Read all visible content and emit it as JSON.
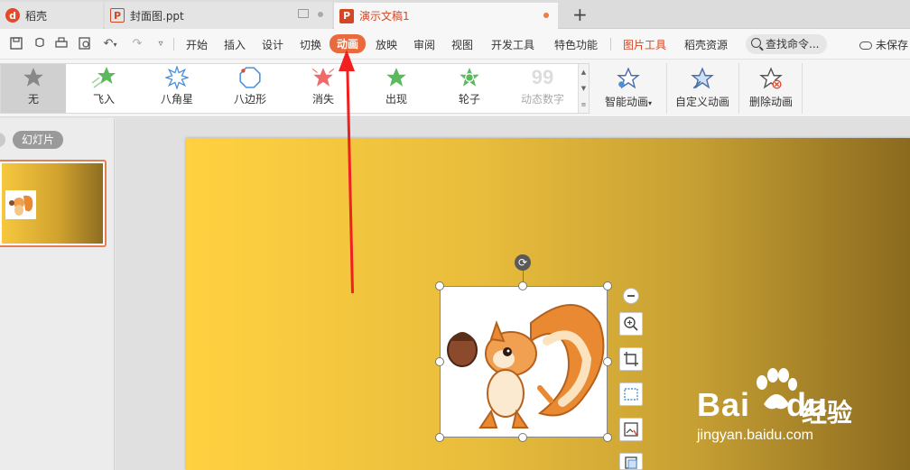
{
  "tabs": [
    {
      "label": "稻壳",
      "icon": "docer-logo-icon"
    },
    {
      "label": "封面图.ppt",
      "icon": "ppt-file-icon"
    },
    {
      "label": "演示文稿1",
      "icon": "ppt-file-icon",
      "active": true
    }
  ],
  "menu": {
    "items": [
      "开始",
      "插入",
      "设计",
      "切换",
      "动画",
      "放映",
      "审阅",
      "视图",
      "开发工具",
      "特色功能",
      "图片工具",
      "稻壳资源"
    ],
    "active": "动画",
    "search_placeholder": "查找命令...",
    "unsaved_label": "未保存"
  },
  "ribbon": {
    "gallery": [
      {
        "label": "无",
        "icon": "star-gray-icon"
      },
      {
        "label": "飞入",
        "icon": "fly-in-star-icon"
      },
      {
        "label": "八角星",
        "icon": "eight-point-star-icon"
      },
      {
        "label": "八边形",
        "icon": "octagon-icon"
      },
      {
        "label": "消失",
        "icon": "disappear-star-icon"
      },
      {
        "label": "出现",
        "icon": "appear-star-icon"
      },
      {
        "label": "轮子",
        "icon": "wheel-star-icon"
      },
      {
        "label": "动态数字",
        "icon": "dynamic-number-icon",
        "disabled": true
      }
    ],
    "buttons": [
      {
        "label": "智能动画",
        "icon": "smart-animation-icon"
      },
      {
        "label": "自定义动画",
        "icon": "custom-animation-icon"
      },
      {
        "label": "删除动画",
        "icon": "delete-animation-icon"
      }
    ]
  },
  "slides_panel": {
    "label": "幻灯片"
  },
  "colors": {
    "accent": "#e96a3d",
    "arrow": "#f02020",
    "slide_gradient_start": "#ffd141",
    "slide_gradient_end": "#8a6a1f"
  },
  "watermark": {
    "brand": "Bai",
    "brand2": "du",
    "cn": "经验",
    "url": "jingyan.baidu.com"
  }
}
